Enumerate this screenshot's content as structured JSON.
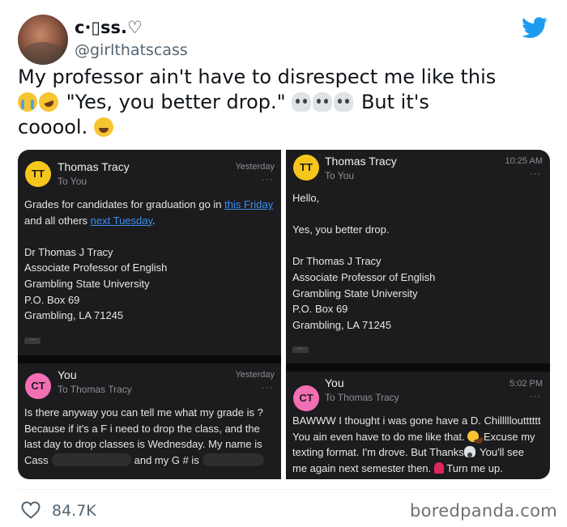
{
  "tweet": {
    "display_name": "c·▯ss.♡",
    "handle": "@girlthatscass",
    "text_line1": "My professor ain't have to disrespect me like this",
    "text_line2_a": "\"Yes, you better drop.\"",
    "text_line2_b": "But it's",
    "text_line3": "cooool.",
    "likes": "84.7K",
    "watermark": "boredpanda.com"
  },
  "left_card": {
    "mail1": {
      "avatar": "TT",
      "from": "Thomas Tracy",
      "to": "To You",
      "time": "Yesterday",
      "dots": "···",
      "body1_pre": "Grades for candidates for graduation go in ",
      "body1_link": "this Friday",
      "body2_pre": "and all others ",
      "body2_link": "next Tuesday",
      "body2_post": ".",
      "sig": [
        "Dr Thomas J Tracy",
        "Associate Professor of English",
        "Grambling State University",
        "P.O. Box 69",
        "Grambling, LA 71245"
      ],
      "more": "···"
    },
    "mail2": {
      "avatar": "CT",
      "from": "You",
      "to": "To Thomas Tracy",
      "time": "Yesterday",
      "dots": "···",
      "line1": "Is there anyway you can tell me what my grade is ?",
      "line2": "Because if it's a F i need to drop the class, and the",
      "line3": "last day to drop classes is Wednesday. My name is",
      "line4_a": "Cass",
      "line4_b": "and my G # is"
    }
  },
  "right_card": {
    "mail1": {
      "avatar": "TT",
      "from": "Thomas Tracy",
      "to": "To You",
      "time": "10:25 AM",
      "dots": "···",
      "greet": "Hello,",
      "line": "Yes, you better drop.",
      "sig": [
        "Dr Thomas J Tracy",
        "Associate Professor of English",
        "Grambling State University",
        "P.O. Box 69",
        "Grambling, LA 71245"
      ],
      "more": "···"
    },
    "mail2": {
      "avatar": "CT",
      "from": "You",
      "to": "To Thomas Tracy",
      "time": "5:02 PM",
      "dots": "···",
      "line1": "BAWWW I thought i was gone have a D. Chillllloutttttt",
      "line2_a": "You ain even have to do me like that.",
      "line2_b": "Excuse my",
      "line3_a": "texting format. I'm drove. But Thanks",
      "line3_b": "You'll see",
      "line4_a": "me again next semester then.",
      "line4_b": "Turn me up."
    }
  },
  "icons": {
    "twitter": "twitter-bird-icon",
    "like": "heart-icon",
    "brand_color": "#1d9bf0"
  }
}
